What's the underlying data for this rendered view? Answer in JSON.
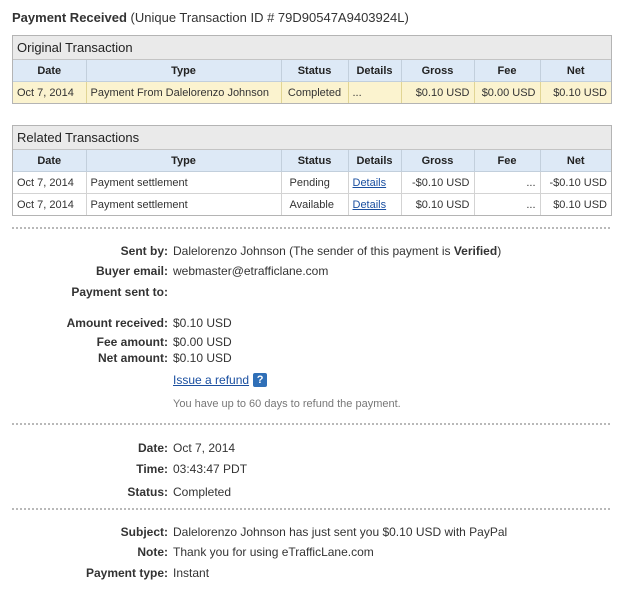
{
  "header": {
    "title": "Payment Received",
    "subtitle": "(Unique Transaction ID # 79D90547A9403924L)"
  },
  "columns": [
    "Date",
    "Type",
    "Status",
    "Details",
    "Gross",
    "Fee",
    "Net"
  ],
  "original": {
    "title": "Original Transaction",
    "row": {
      "date": "Oct 7, 2014",
      "type": "Payment From Dalelorenzo Johnson",
      "status": "Completed",
      "details": "...",
      "gross": "$0.10 USD",
      "fee": "$0.00 USD",
      "net": "$0.10 USD"
    }
  },
  "related": {
    "title": "Related Transactions",
    "rows": [
      {
        "date": "Oct 7, 2014",
        "type": "Payment settlement",
        "status": "Pending",
        "details": "Details",
        "gross": "-$0.10 USD",
        "fee": "...",
        "net": "-$0.10 USD"
      },
      {
        "date": "Oct 7, 2014",
        "type": "Payment settlement",
        "status": "Available",
        "details": "Details",
        "gross": "$0.10 USD",
        "fee": "...",
        "net": "$0.10 USD"
      }
    ]
  },
  "sender": {
    "sent_by_label": "Sent by:",
    "sent_by_name": "Dalelorenzo Johnson",
    "sent_by_note_pre": " (The sender of this payment is ",
    "sent_by_note_status": "Verified",
    "sent_by_note_post": ")",
    "buyer_email_label": "Buyer email:",
    "buyer_email": "webmaster@etrafficlane.com",
    "payment_sent_to_label": "Payment sent to:",
    "payment_sent_to": ""
  },
  "amounts": {
    "received_label": "Amount received:",
    "received": "$0.10 USD",
    "fee_label": "Fee amount:",
    "fee": "$0.00 USD",
    "net_label": "Net amount:",
    "net": "$0.10 USD",
    "refund_link": "Issue a refund",
    "help_glyph": "?",
    "refund_note": "You have up to 60 days to refund the payment."
  },
  "timing": {
    "date_label": "Date:",
    "date": "Oct 7, 2014",
    "time_label": "Time:",
    "time": "03:43:47 PDT",
    "status_label": "Status:",
    "status": "Completed"
  },
  "message": {
    "subject_label": "Subject:",
    "subject": "Dalelorenzo Johnson has just sent you $0.10 USD with PayPal",
    "note_label": "Note:",
    "note": "Thank you for using eTrafficLane.com",
    "payment_type_label": "Payment type:",
    "payment_type": "Instant"
  },
  "colors": {
    "table_header_bg": "#dde9f6",
    "highlight_row_bg": "#fbf3cf",
    "link": "#1a4fa0"
  }
}
